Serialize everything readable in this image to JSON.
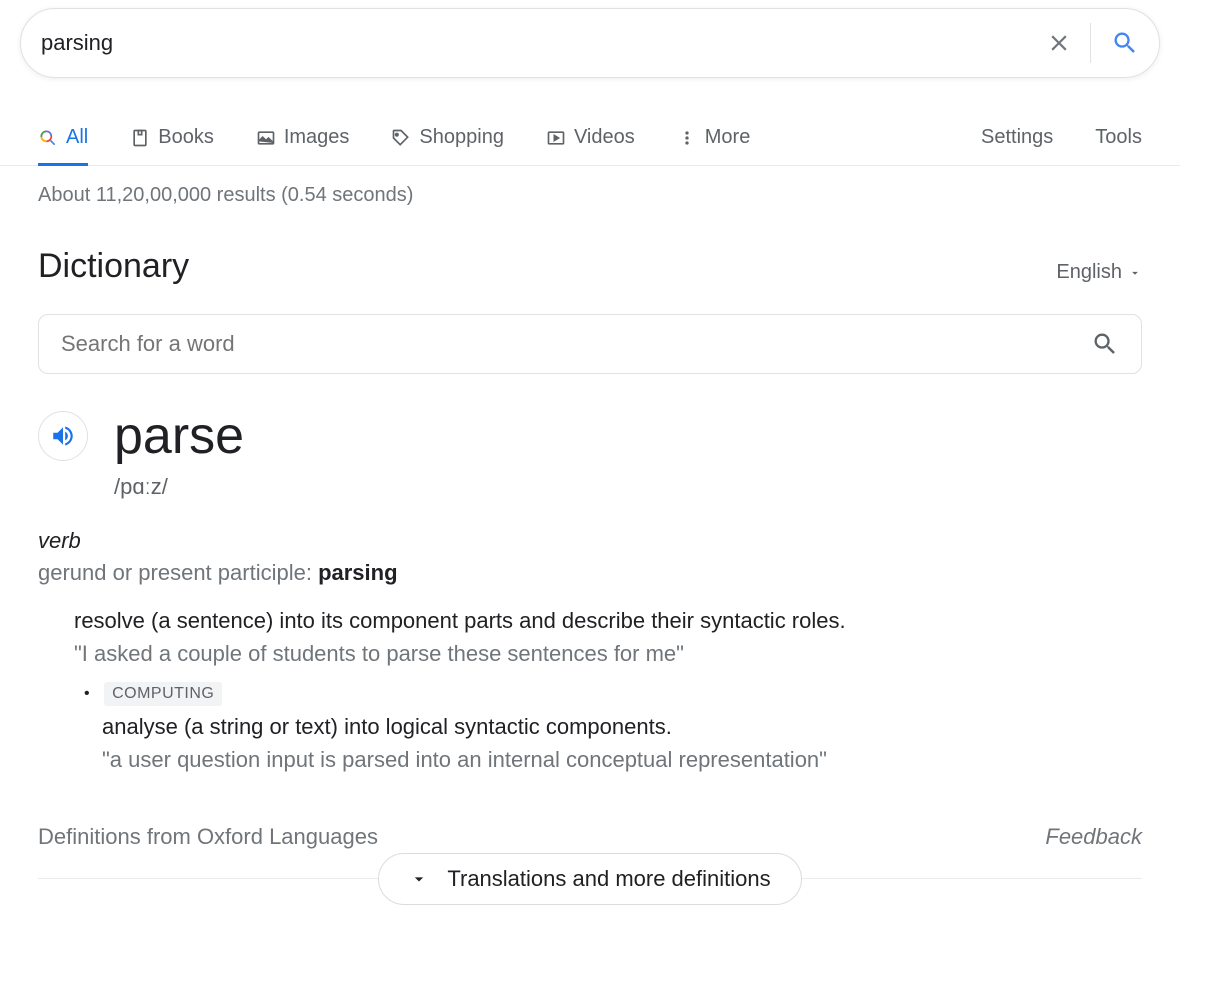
{
  "search": {
    "query": "parsing"
  },
  "tabs": {
    "all": "All",
    "books": "Books",
    "images": "Images",
    "shopping": "Shopping",
    "videos": "Videos",
    "more": "More",
    "settings": "Settings",
    "tools": "Tools"
  },
  "stats": "About 11,20,00,000 results (0.54 seconds)",
  "dictionary": {
    "title": "Dictionary",
    "language": "English",
    "search_placeholder": "Search for a word",
    "word": "parse",
    "pronunciation": "/pɑːz/",
    "pos": "verb",
    "form_prefix": "gerund or present participle: ",
    "form_value": "parsing",
    "def1": "resolve (a sentence) into its component parts and describe their syntactic roles.",
    "ex1": "\"I asked a couple of students to parse these sentences for me\"",
    "sub_tag": "COMPUTING",
    "sub_def": "analyse (a string or text) into logical syntactic components.",
    "sub_ex": "\"a user question input is parsed into an internal conceptual representation\"",
    "source": "Definitions from Oxford Languages",
    "feedback": "Feedback",
    "expand": "Translations and more definitions"
  }
}
